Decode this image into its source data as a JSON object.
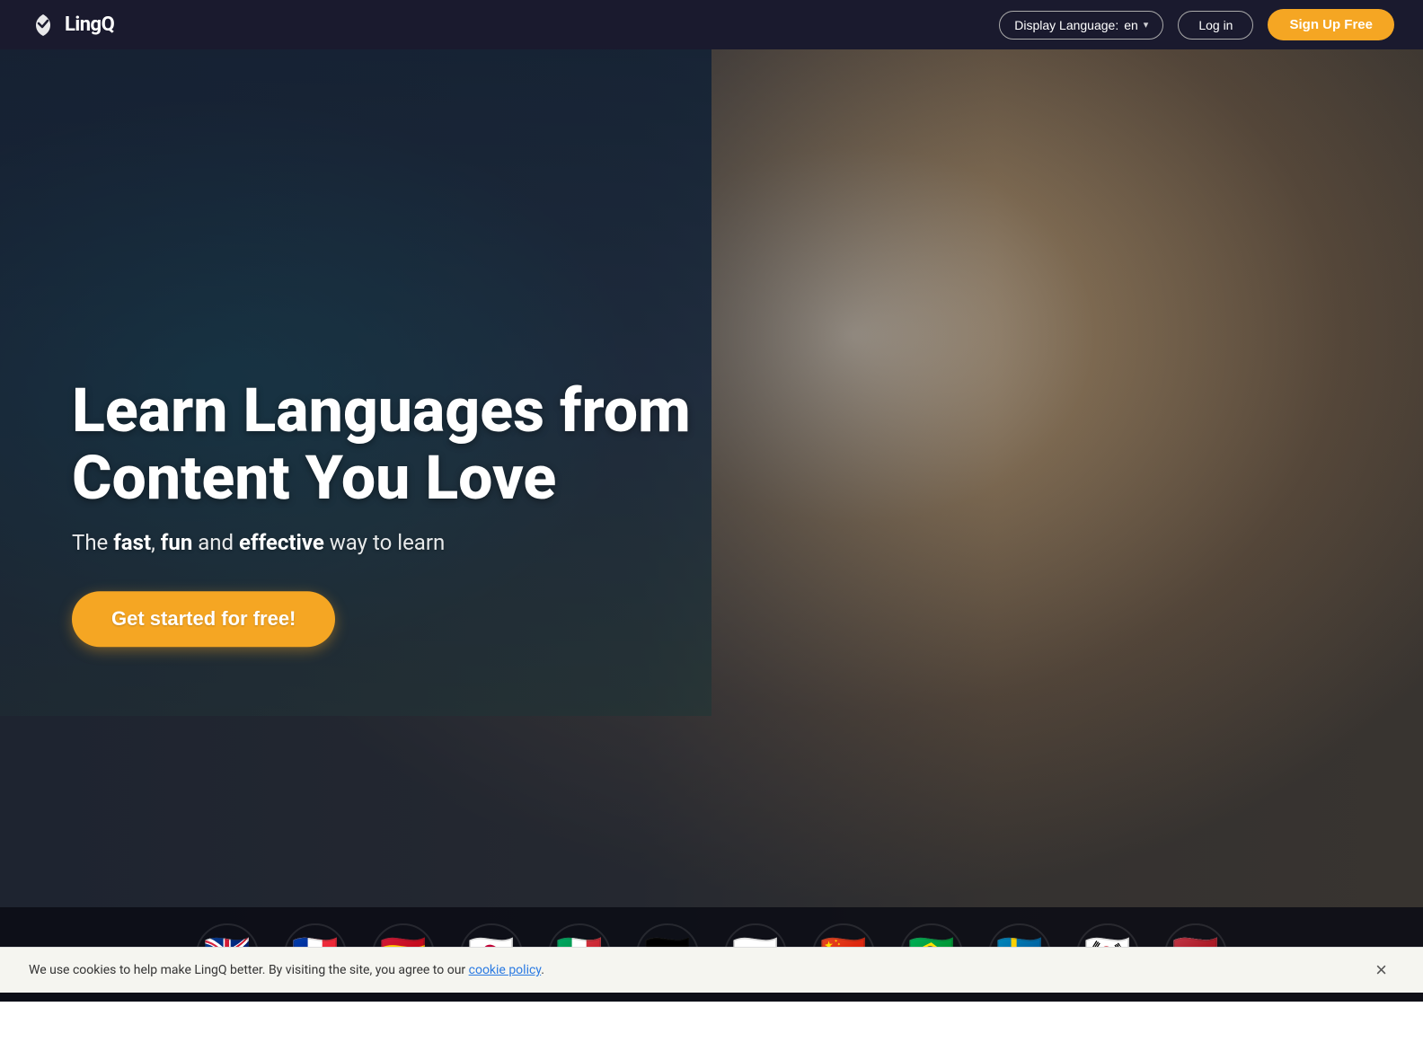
{
  "nav": {
    "logo_text": "LingQ",
    "display_language_label": "Display Language:",
    "display_language_value": "en",
    "login_label": "Log in",
    "signup_label": "Sign Up Free"
  },
  "hero": {
    "title_line1": "Learn Languages from",
    "title_line2": "Content You Love",
    "subtitle_prefix": "The ",
    "subtitle_fast": "fast",
    "subtitle_comma": ", ",
    "subtitle_fun": "fun",
    "subtitle_middle": " and ",
    "subtitle_effective": "effective",
    "subtitle_suffix": " way to learn",
    "cta_label": "Get started for free!"
  },
  "flags": [
    {
      "id": "uk",
      "label": "English",
      "emoji_class": "flag-uk"
    },
    {
      "id": "fr",
      "label": "French",
      "emoji_class": "flag-fr"
    },
    {
      "id": "es",
      "label": "Spanish",
      "emoji_class": "flag-es"
    },
    {
      "id": "jp",
      "label": "Japanese",
      "emoji_class": "flag-jp"
    },
    {
      "id": "it",
      "label": "Italian",
      "emoji_class": "flag-it"
    },
    {
      "id": "de",
      "label": "German",
      "emoji_class": "flag-de"
    },
    {
      "id": "ru",
      "label": "Russian",
      "emoji_class": "flag-ru"
    },
    {
      "id": "cn",
      "label": "Chinese",
      "emoji_class": "flag-cn"
    },
    {
      "id": "br",
      "label": "Portuguese",
      "emoji_class": "flag-br"
    },
    {
      "id": "se",
      "label": "Swedish",
      "emoji_class": "flag-se"
    },
    {
      "id": "kr",
      "label": "Korean",
      "emoji_class": "flag-kr"
    },
    {
      "id": "nl",
      "label": "Dutch",
      "emoji_class": "flag-nl"
    }
  ],
  "cookie": {
    "message": "We use cookies to help make LingQ better. By visiting the site, you agree to our ",
    "link_text": "cookie policy",
    "close_label": "×"
  }
}
